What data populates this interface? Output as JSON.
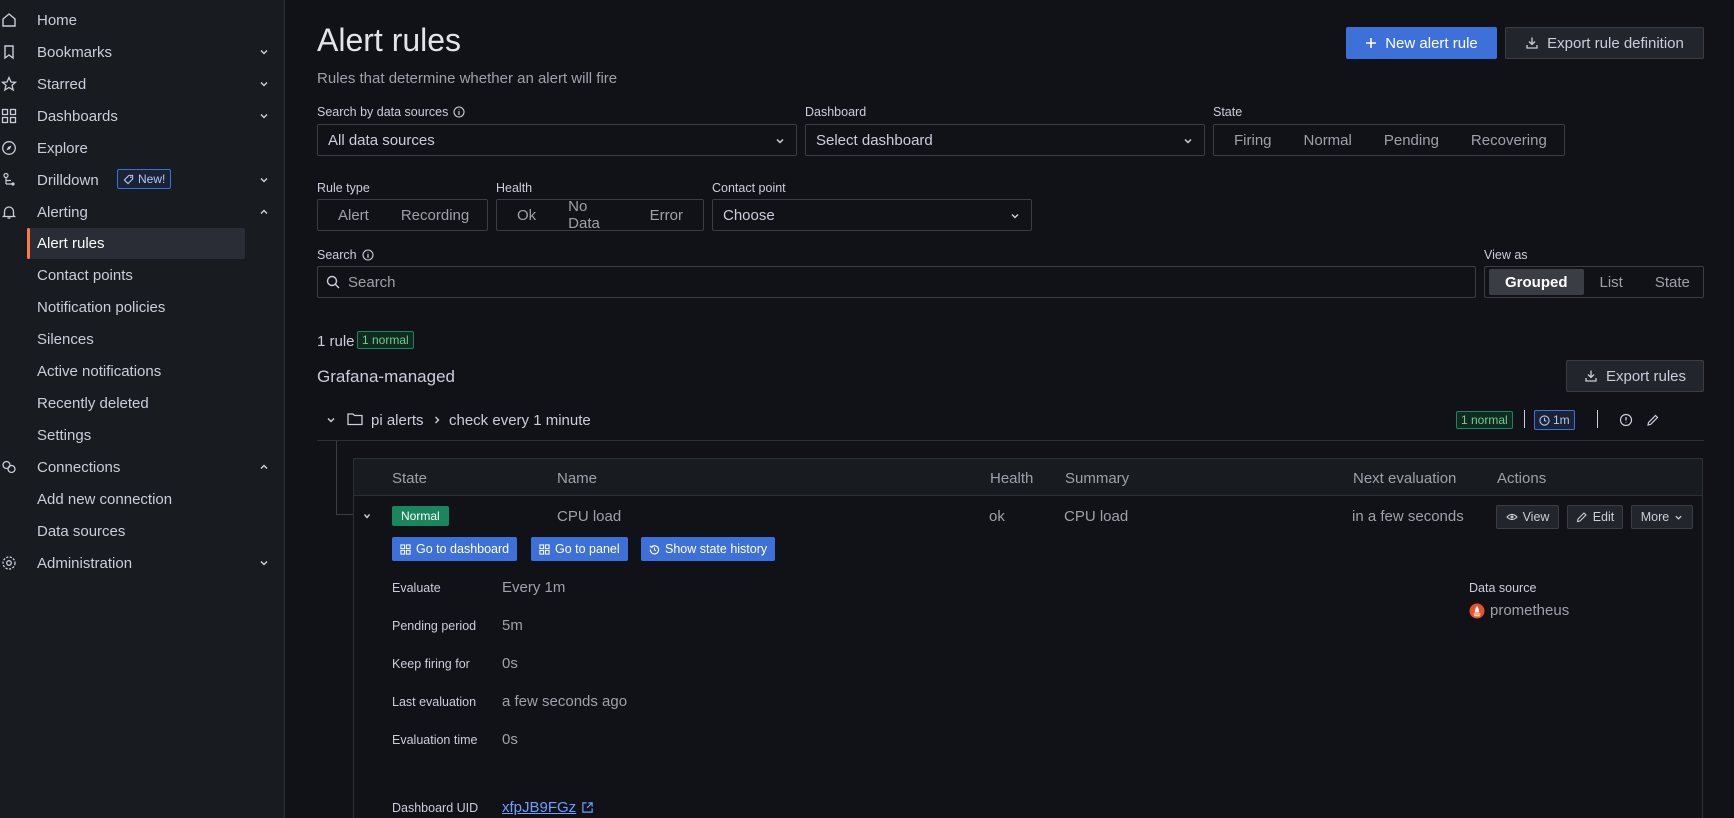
{
  "sidebar": {
    "items": [
      {
        "label": "Home"
      },
      {
        "label": "Bookmarks"
      },
      {
        "label": "Starred"
      },
      {
        "label": "Dashboards"
      },
      {
        "label": "Explore"
      },
      {
        "label": "Drilldown",
        "badge": "New!"
      },
      {
        "label": "Alerting"
      },
      {
        "label": "Connections"
      },
      {
        "label": "Administration"
      }
    ],
    "alerting_sub": [
      "Alert rules",
      "Contact points",
      "Notification policies",
      "Silences",
      "Active notifications",
      "Recently deleted",
      "Settings"
    ],
    "connections_sub": [
      "Add new connection",
      "Data sources"
    ],
    "accent": "#ff7941"
  },
  "header": {
    "title": "Alert rules",
    "subtitle": "Rules that determine whether an alert will fire",
    "new_rule": "New alert rule",
    "export_def": "Export rule definition"
  },
  "filters": {
    "ds_label": "Search by data sources",
    "ds_value": "All data sources",
    "dashboard_label": "Dashboard",
    "dashboard_placeholder": "Select dashboard",
    "state_label": "State",
    "states": [
      "Firing",
      "Normal",
      "Pending",
      "Recovering"
    ],
    "rule_type_label": "Rule type",
    "rule_types": [
      "Alert",
      "Recording"
    ],
    "health_label": "Health",
    "health": [
      "Ok",
      "No Data",
      "Error"
    ],
    "contact_label": "Contact point",
    "contact_placeholder": "Choose",
    "search_label": "Search",
    "search_placeholder": "Search",
    "view_label": "View as",
    "views": [
      "Grouped",
      "List",
      "State"
    ]
  },
  "summary": {
    "count": "1 rule",
    "normal_badge": "1 normal"
  },
  "group": {
    "section": "Grafana-managed",
    "export_rules": "Export rules",
    "folder": "pi alerts",
    "name": "check every 1 minute",
    "normal_badge": "1 normal",
    "interval": "1m"
  },
  "table": {
    "headers": [
      "State",
      "Name",
      "Health",
      "Summary",
      "Next evaluation",
      "Actions"
    ],
    "row": {
      "state": "Normal",
      "name": "CPU load",
      "health": "ok",
      "summary": "CPU load",
      "next": "in a few seconds",
      "view": "View",
      "edit": "Edit",
      "more": "More"
    }
  },
  "details": {
    "buttons": [
      "Go to dashboard",
      "Go to panel",
      "Show state history"
    ],
    "fields": [
      {
        "label": "Evaluate",
        "value": "Every 1m"
      },
      {
        "label": "Pending period",
        "value": "5m"
      },
      {
        "label": "Keep firing for",
        "value": "0s"
      },
      {
        "label": "Last evaluation",
        "value": "a few seconds ago"
      },
      {
        "label": "Evaluation time",
        "value": "0s"
      }
    ],
    "ds_label": "Data source",
    "ds_value": "prometheus",
    "uid_label": "Dashboard UID",
    "uid_value": "xfpJB9FGz"
  }
}
